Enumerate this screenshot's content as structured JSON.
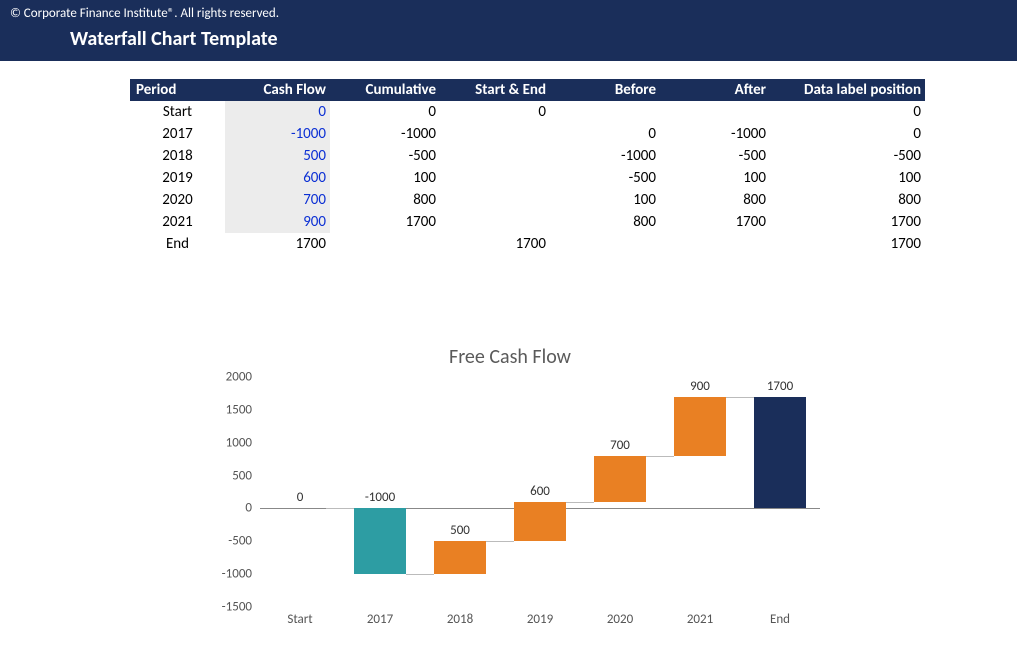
{
  "header": {
    "copyright": "© Corporate Finance Institute®. All rights reserved.",
    "title": "Waterfall Chart Template"
  },
  "table": {
    "headers": {
      "period": "Period",
      "cash_flow": "Cash Flow",
      "cumulative": "Cumulative",
      "start_end": "Start & End",
      "before": "Before",
      "after": "After",
      "dlp": "Data label position"
    },
    "rows": [
      {
        "period": "Start",
        "cash_flow": "0",
        "cf_blue": true,
        "cumulative": "0",
        "start_end": "0",
        "before": "",
        "after": "",
        "dlp": "0"
      },
      {
        "period": "2017",
        "cash_flow": "-1000",
        "cf_blue": true,
        "cumulative": "-1000",
        "start_end": "",
        "before": "0",
        "after": "-1000",
        "dlp": "0"
      },
      {
        "period": "2018",
        "cash_flow": "500",
        "cf_blue": true,
        "cumulative": "-500",
        "start_end": "",
        "before": "-1000",
        "after": "-500",
        "dlp": "-500"
      },
      {
        "period": "2019",
        "cash_flow": "600",
        "cf_blue": true,
        "cumulative": "100",
        "start_end": "",
        "before": "-500",
        "after": "100",
        "dlp": "100"
      },
      {
        "period": "2020",
        "cash_flow": "700",
        "cf_blue": true,
        "cumulative": "800",
        "start_end": "",
        "before": "100",
        "after": "800",
        "dlp": "800"
      },
      {
        "period": "2021",
        "cash_flow": "900",
        "cf_blue": true,
        "cumulative": "1700",
        "start_end": "",
        "before": "800",
        "after": "1700",
        "dlp": "1700"
      },
      {
        "period": "End",
        "cash_flow": "1700",
        "cf_blue": false,
        "cumulative": "",
        "start_end": "1700",
        "before": "",
        "after": "",
        "dlp": "1700"
      }
    ]
  },
  "chart_data": {
    "type": "bar",
    "title": "Free Cash Flow",
    "categories": [
      "Start",
      "2017",
      "2018",
      "2019",
      "2020",
      "2021",
      "End"
    ],
    "values": [
      0,
      -1000,
      500,
      600,
      700,
      900,
      1700
    ],
    "cumulative": [
      0,
      -1000,
      -500,
      100,
      800,
      1700,
      1700
    ],
    "data_labels": [
      "0",
      "-1000",
      "500",
      "600",
      "700",
      "900",
      "1700"
    ],
    "yticks": [
      -1500,
      -1000,
      -500,
      0,
      500,
      1000,
      1500,
      2000
    ],
    "ylim": [
      -1500,
      2000
    ],
    "colors": {
      "pos": "#e98023",
      "neg": "#2d9da3",
      "end": "#1a2e5a"
    }
  }
}
